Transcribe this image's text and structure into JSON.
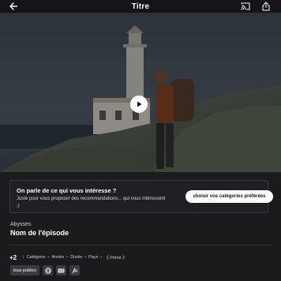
{
  "header": {
    "title": "Titre",
    "back_icon": "arrow-left-icon",
    "cast_icon": "cast-icon",
    "share_icon": "share-icon"
  },
  "hero": {
    "play_icon": "play-icon"
  },
  "recommendation_card": {
    "heading": "On parle de ce qui vous intéresse  ?",
    "description": "Juste pour vous proposer des recommandations... qui vous intéressent ;)",
    "button_label": "choisir vos catégories préférées"
  },
  "episode": {
    "series": "Abysses",
    "title": "Nom de l'épisode"
  },
  "meta": {
    "rating": "+2",
    "items": [
      "Catégorie",
      "Année",
      "Durée",
      "Pays",
      "《 Primé 》"
    ]
  },
  "badges": {
    "audience": "tous publics",
    "icons": [
      "globe-icon",
      "hd-icon",
      "audio-description-icon"
    ]
  },
  "colors": {
    "background": "#1b1b1d",
    "card_background": "#1f2023",
    "button": "#ffffff"
  }
}
